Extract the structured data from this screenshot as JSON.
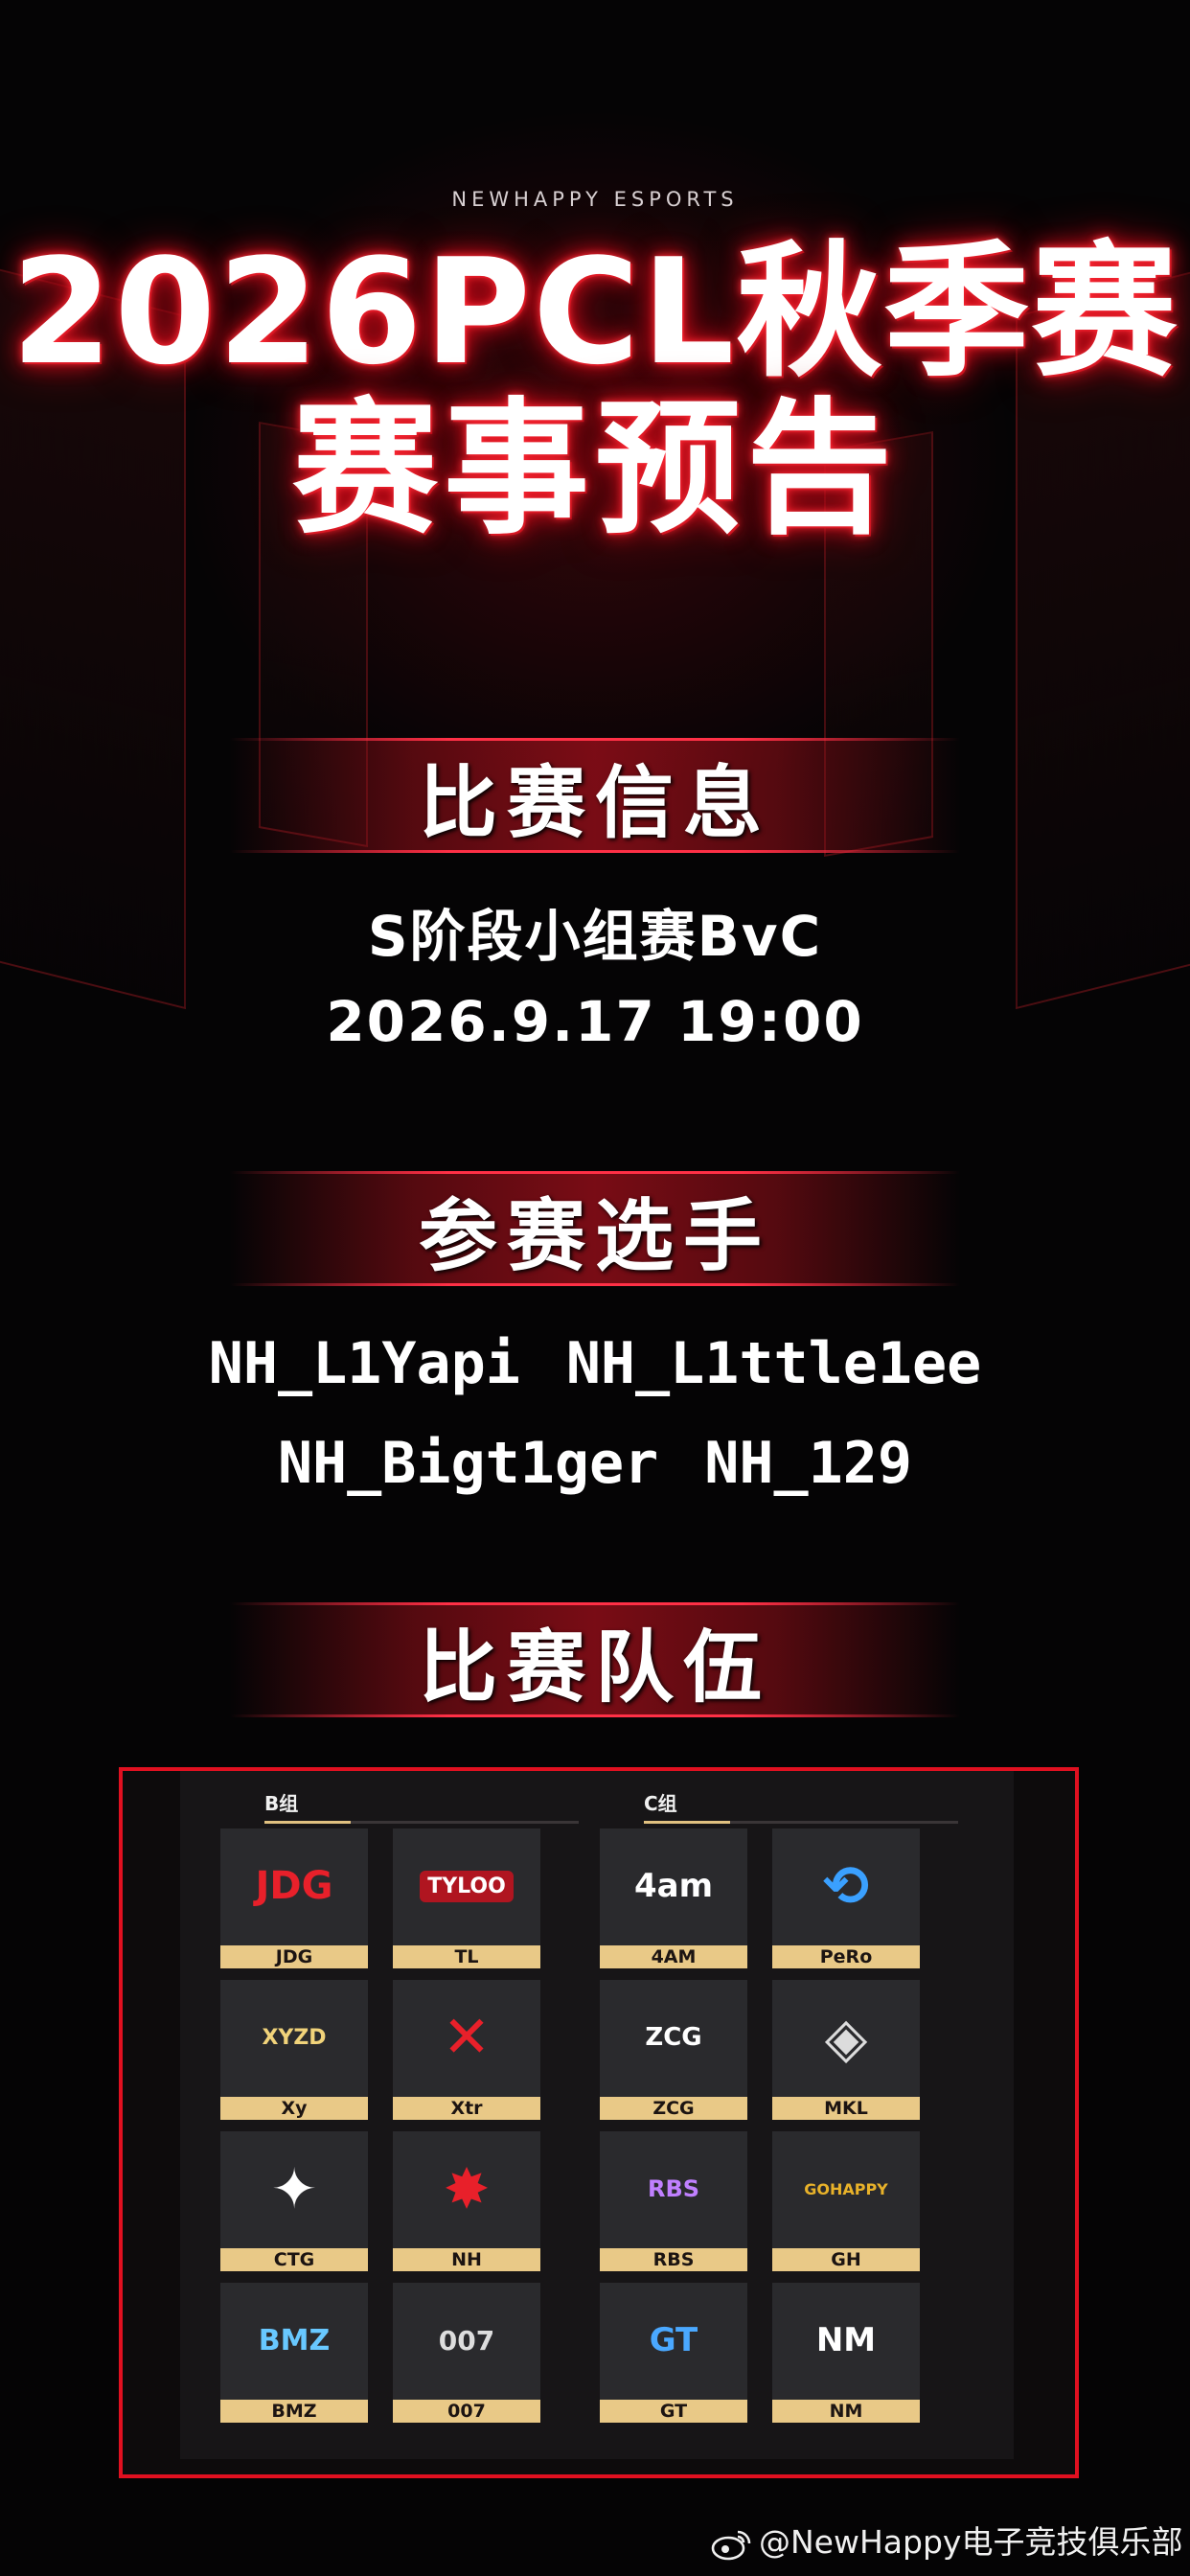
{
  "brand": "NEWHAPPY ESPORTS",
  "title": {
    "line1": "2026PCL秋季赛",
    "line2": "赛事预告"
  },
  "sections": {
    "match_info": {
      "heading": "比赛信息",
      "stage": "S阶段小组赛BvC",
      "datetime": "2026.9.17 19:00"
    },
    "players": {
      "heading": "参赛选手",
      "names": [
        "NH_L1Yapi",
        "NH_L1ttle1ee",
        "NH_Bigt1ger",
        "NH_129"
      ]
    },
    "teams": {
      "heading": "比赛队伍",
      "group_b": {
        "label": "B组",
        "teams": [
          {
            "name": "JDG",
            "icon": "jdg-logo"
          },
          {
            "name": "TL",
            "icon": "tyloo-logo",
            "logo_text": "TYLOO"
          },
          {
            "name": "Xy",
            "icon": "xyzd-logo",
            "logo_text": "XYZD"
          },
          {
            "name": "Xtr",
            "icon": "xtr-logo"
          },
          {
            "name": "CTG",
            "icon": "ctg-logo"
          },
          {
            "name": "NH",
            "icon": "newhappy-logo"
          },
          {
            "name": "BMZ",
            "icon": "bmz-logo",
            "logo_text": "BMZ"
          },
          {
            "name": "007",
            "icon": "007-dragon-logo",
            "logo_text": "007"
          }
        ]
      },
      "group_c": {
        "label": "C组",
        "teams": [
          {
            "name": "4AM",
            "icon": "4am-logo",
            "logo_text": "4am"
          },
          {
            "name": "PeRo",
            "icon": "pero-logo"
          },
          {
            "name": "ZCG",
            "icon": "zcg-logo",
            "logo_text": "ZCG"
          },
          {
            "name": "MKL",
            "icon": "mkl-logo"
          },
          {
            "name": "RBS",
            "icon": "rbs-logo",
            "logo_text": "RBS"
          },
          {
            "name": "GH",
            "icon": "gh-logo",
            "logo_text": "GOHAPPY"
          },
          {
            "name": "GT",
            "icon": "gt-logo",
            "logo_text": "GT"
          },
          {
            "name": "NM",
            "icon": "nm-logo",
            "logo_text": "NM"
          }
        ]
      }
    }
  },
  "watermark": {
    "text": "@NewHappy电子竞技俱乐部",
    "icon": "weibo-icon"
  },
  "colors": {
    "accent": "#e01020",
    "gold": "#e9c987",
    "background": "#050405"
  }
}
